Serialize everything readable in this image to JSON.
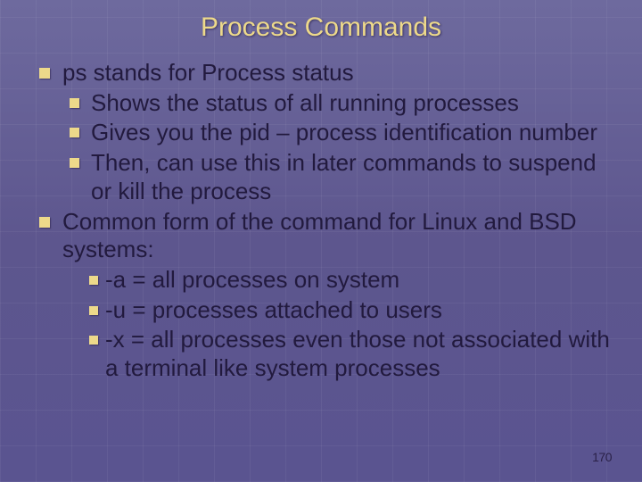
{
  "title": "Process Commands",
  "bullets": {
    "lvl1": [
      {
        "text": "ps stands for Process status",
        "children": [
          {
            "text": "Shows the status of all running processes"
          },
          {
            "text": "Gives you the pid – process identification number"
          },
          {
            "text": "Then, can use this in later commands to suspend or kill the process"
          }
        ]
      },
      {
        "text": "Common form of the command for Linux and BSD systems:",
        "children3": [
          {
            "text": "-a = all processes on system"
          },
          {
            "text": "-u = processes attached to users"
          },
          {
            "text": "-x = all processes even those not associated with a terminal like system processes"
          }
        ]
      }
    ]
  },
  "page_number": "170"
}
